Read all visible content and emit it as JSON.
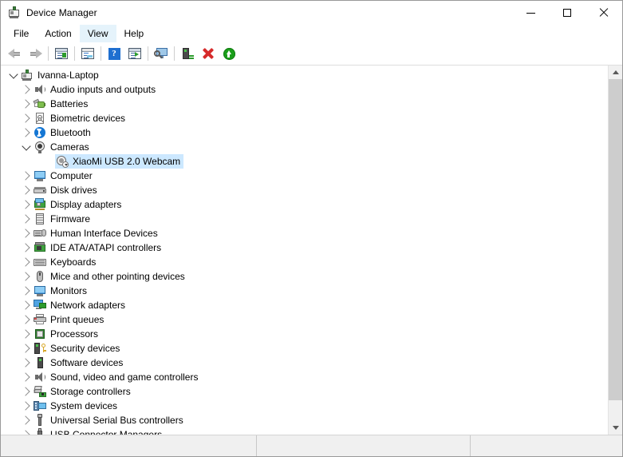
{
  "window": {
    "title": "Device Manager",
    "title_icon": "device-manager-icon",
    "controls": {
      "minimize": "minimize-icon",
      "maximize": "maximize-icon",
      "close": "close-icon"
    }
  },
  "menubar": {
    "items": [
      {
        "label": "File",
        "active": false
      },
      {
        "label": "Action",
        "active": false
      },
      {
        "label": "View",
        "active": true
      },
      {
        "label": "Help",
        "active": false
      }
    ]
  },
  "toolbar": {
    "buttons": [
      {
        "name": "back-button",
        "icon": "back-arrow-icon",
        "enabled": false
      },
      {
        "name": "forward-button",
        "icon": "forward-arrow-icon",
        "enabled": false
      },
      {
        "name": "show-hide-console-tree-button",
        "icon": "console-tree-icon",
        "enabled": true
      },
      {
        "name": "properties-button",
        "icon": "properties-icon",
        "enabled": true
      },
      {
        "name": "help-button",
        "icon": "help-question-icon",
        "enabled": true
      },
      {
        "name": "show-hide-action-pane-button",
        "icon": "action-pane-icon",
        "enabled": true
      },
      {
        "name": "scan-for-hardware-changes-button",
        "icon": "scan-computer-icon",
        "enabled": true
      },
      {
        "name": "update-driver-button",
        "icon": "update-driver-icon",
        "enabled": true
      },
      {
        "name": "uninstall-device-button",
        "icon": "red-x-icon",
        "enabled": true
      },
      {
        "name": "enable-device-button",
        "icon": "green-up-arrow-icon",
        "enabled": true
      }
    ]
  },
  "tree": {
    "rows": [
      {
        "label": "Ivanna-Laptop",
        "level": 0,
        "expander": "down",
        "icon": "computer-root-icon",
        "selected": false
      },
      {
        "label": "Audio inputs and outputs",
        "level": 1,
        "expander": "right",
        "icon": "speaker-icon",
        "selected": false
      },
      {
        "label": "Batteries",
        "level": 1,
        "expander": "right",
        "icon": "battery-icon",
        "selected": false
      },
      {
        "label": "Biometric devices",
        "level": 1,
        "expander": "right",
        "icon": "fingerprint-icon",
        "selected": false
      },
      {
        "label": "Bluetooth",
        "level": 1,
        "expander": "right",
        "icon": "bluetooth-icon",
        "selected": false
      },
      {
        "label": "Cameras",
        "level": 1,
        "expander": "down",
        "icon": "camera-icon",
        "selected": false
      },
      {
        "label": "XiaoMi USB 2.0 Webcam",
        "level": 2,
        "expander": "none",
        "icon": "webcam-icon",
        "selected": true
      },
      {
        "label": "Computer",
        "level": 1,
        "expander": "right",
        "icon": "monitor-icon",
        "selected": false
      },
      {
        "label": "Disk drives",
        "level": 1,
        "expander": "right",
        "icon": "disk-drive-icon",
        "selected": false
      },
      {
        "label": "Display adapters",
        "level": 1,
        "expander": "right",
        "icon": "display-adapter-icon",
        "selected": false
      },
      {
        "label": "Firmware",
        "level": 1,
        "expander": "right",
        "icon": "firmware-chip-icon",
        "selected": false
      },
      {
        "label": "Human Interface Devices",
        "level": 1,
        "expander": "right",
        "icon": "human-interface-icon",
        "selected": false
      },
      {
        "label": "IDE ATA/ATAPI controllers",
        "level": 1,
        "expander": "right",
        "icon": "ide-controller-icon",
        "selected": false
      },
      {
        "label": "Keyboards",
        "level": 1,
        "expander": "right",
        "icon": "keyboard-icon",
        "selected": false
      },
      {
        "label": "Mice and other pointing devices",
        "level": 1,
        "expander": "right",
        "icon": "mouse-icon",
        "selected": false
      },
      {
        "label": "Monitors",
        "level": 1,
        "expander": "right",
        "icon": "monitor-icon",
        "selected": false
      },
      {
        "label": "Network adapters",
        "level": 1,
        "expander": "right",
        "icon": "network-adapter-icon",
        "selected": false
      },
      {
        "label": "Print queues",
        "level": 1,
        "expander": "right",
        "icon": "printer-icon",
        "selected": false
      },
      {
        "label": "Processors",
        "level": 1,
        "expander": "right",
        "icon": "processor-icon",
        "selected": false
      },
      {
        "label": "Security devices",
        "level": 1,
        "expander": "right",
        "icon": "security-key-icon",
        "selected": false
      },
      {
        "label": "Software devices",
        "level": 1,
        "expander": "right",
        "icon": "software-device-icon",
        "selected": false
      },
      {
        "label": "Sound, video and game controllers",
        "level": 1,
        "expander": "right",
        "icon": "speaker-icon",
        "selected": false
      },
      {
        "label": "Storage controllers",
        "level": 1,
        "expander": "right",
        "icon": "storage-controller-icon",
        "selected": false
      },
      {
        "label": "System devices",
        "level": 1,
        "expander": "right",
        "icon": "system-device-icon",
        "selected": false
      },
      {
        "label": "Universal Serial Bus controllers",
        "level": 1,
        "expander": "right",
        "icon": "usb-icon",
        "selected": false
      },
      {
        "label": "USB Connector Managers",
        "level": 1,
        "expander": "right",
        "icon": "usb-connector-icon",
        "selected": false
      }
    ]
  },
  "scrollbar": {
    "up_arrow": "scroll-up-icon",
    "down_arrow": "scroll-down-icon",
    "thumb_top_pct": 0,
    "thumb_height_pct": 94
  },
  "statusbar": {
    "pane1": "",
    "pane2": "",
    "pane3": ""
  },
  "colors": {
    "selection": "#cce8ff",
    "menu_hover": "#e5f3fb",
    "window_bg": "#ffffff",
    "statusbar_bg": "#f0f0f0",
    "scrollbar_thumb": "#cdcdcd"
  }
}
